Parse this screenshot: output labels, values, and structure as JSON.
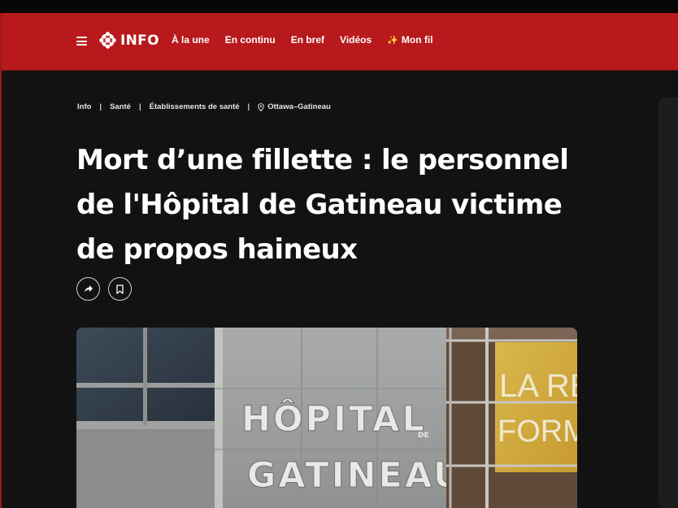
{
  "nav": {
    "logo_text": "INFO",
    "links": [
      "À la une",
      "En continu",
      "En bref",
      "Vidéos",
      "Mon fil"
    ]
  },
  "breadcrumb": {
    "items": [
      "Info",
      "Santé",
      "Établissements de santé"
    ],
    "location": "Ottawa–Gatineau"
  },
  "article": {
    "headline": "Mort d’une fillette : le personnel de l'Hôpital de Gatineau victime de propos haineux",
    "photo_sign_line1": "HÔPITAL",
    "photo_sign_small": "DE",
    "photo_sign_line2": "GATINEAU",
    "photo_poster_line1": "LA RE",
    "photo_poster_line2": "FORM"
  },
  "colors": {
    "brand_red": "#b7191c",
    "background": "#121212",
    "text": "#ffffff"
  },
  "icons": [
    "menu-icon",
    "radio-canada-gem-icon",
    "sparkle-icon",
    "location-pin-icon",
    "share-arrow-icon",
    "bookmark-icon"
  ]
}
